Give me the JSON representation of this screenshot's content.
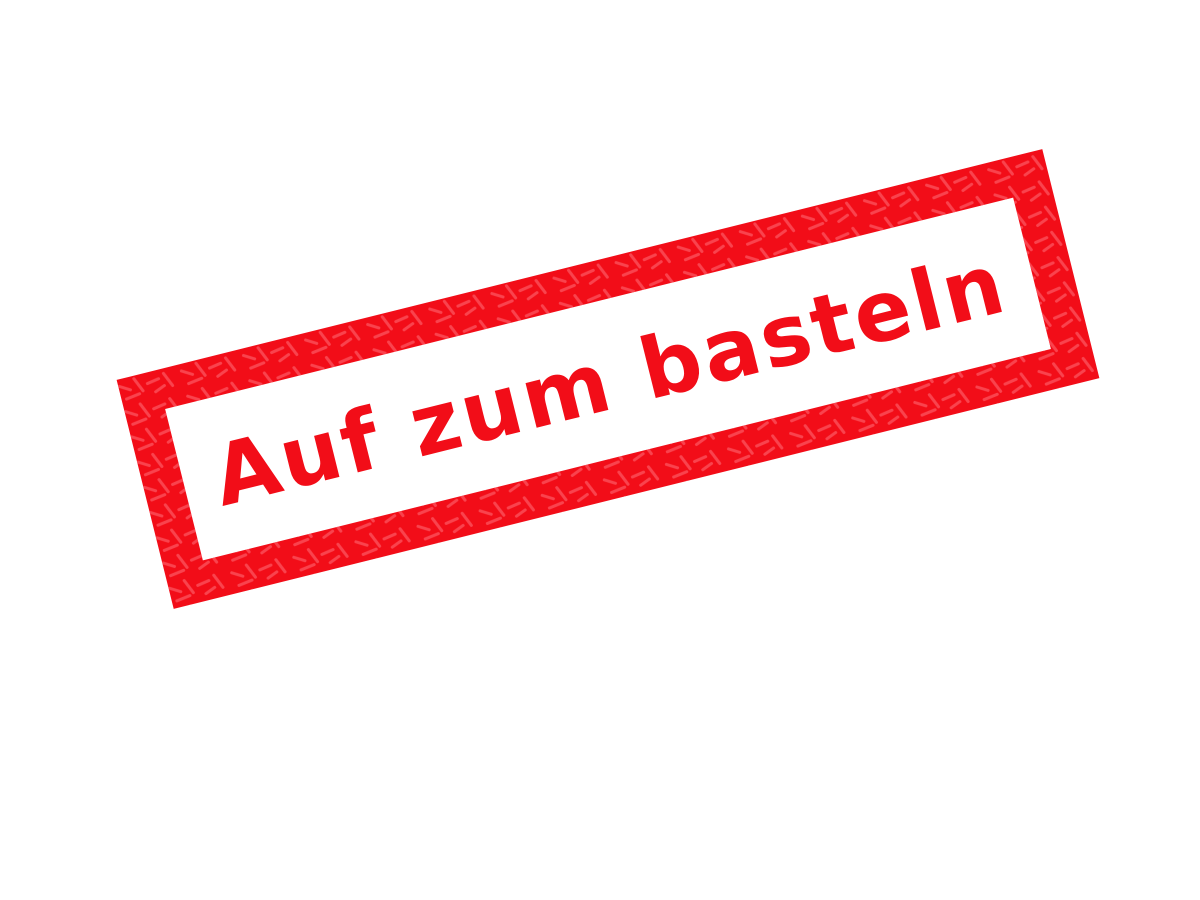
{
  "stamp": {
    "text": "Auf zum basteln",
    "color": "#f20d18",
    "texture_color": "#ff6f7a",
    "rotation_deg": -14,
    "icon": "rubber-stamp-icon"
  }
}
